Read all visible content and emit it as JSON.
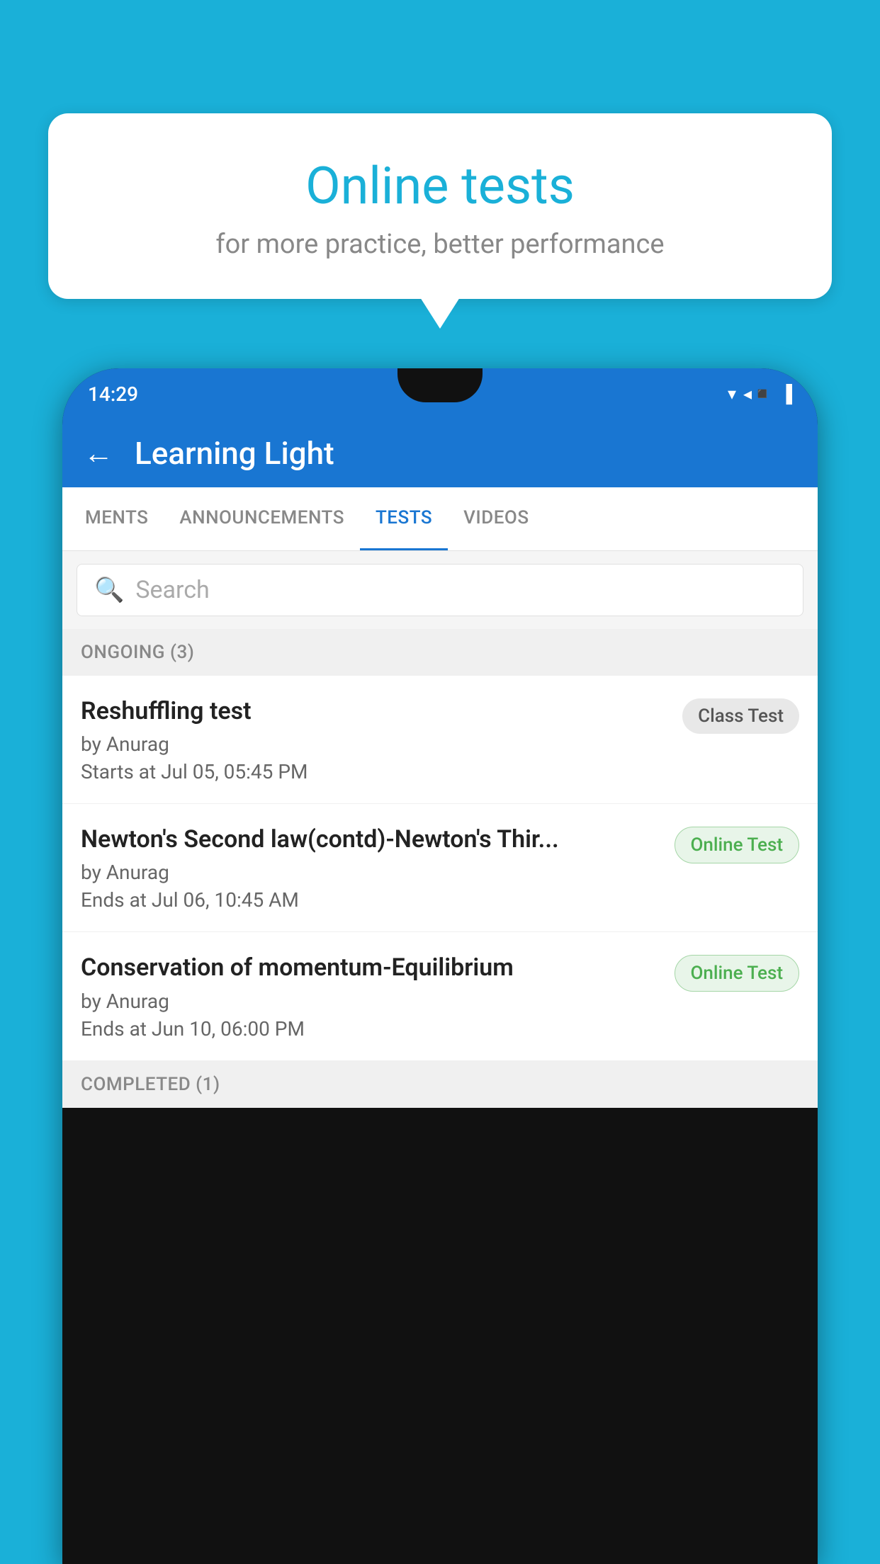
{
  "background": {
    "color": "#1ab0d8"
  },
  "speechBubble": {
    "title": "Online tests",
    "subtitle": "for more practice, better performance"
  },
  "phone": {
    "statusBar": {
      "time": "14:29",
      "icons": [
        "▼",
        "◀",
        "▐"
      ]
    },
    "appBar": {
      "backLabel": "←",
      "title": "Learning Light"
    },
    "tabs": [
      {
        "label": "MENTS",
        "active": false
      },
      {
        "label": "ANNOUNCEMENTS",
        "active": false
      },
      {
        "label": "TESTS",
        "active": true
      },
      {
        "label": "VIDEOS",
        "active": false
      }
    ],
    "search": {
      "placeholder": "Search"
    },
    "ongoingSection": {
      "label": "ONGOING (3)"
    },
    "tests": [
      {
        "title": "Reshuffling test",
        "by": "by Anurag",
        "time": "Starts at  Jul 05, 05:45 PM",
        "badge": "Class Test",
        "badgeType": "class"
      },
      {
        "title": "Newton's Second law(contd)-Newton's Thir...",
        "by": "by Anurag",
        "time": "Ends at  Jul 06, 10:45 AM",
        "badge": "Online Test",
        "badgeType": "online"
      },
      {
        "title": "Conservation of momentum-Equilibrium",
        "by": "by Anurag",
        "time": "Ends at  Jun 10, 06:00 PM",
        "badge": "Online Test",
        "badgeType": "online"
      }
    ],
    "completedSection": {
      "label": "COMPLETED (1)"
    }
  }
}
